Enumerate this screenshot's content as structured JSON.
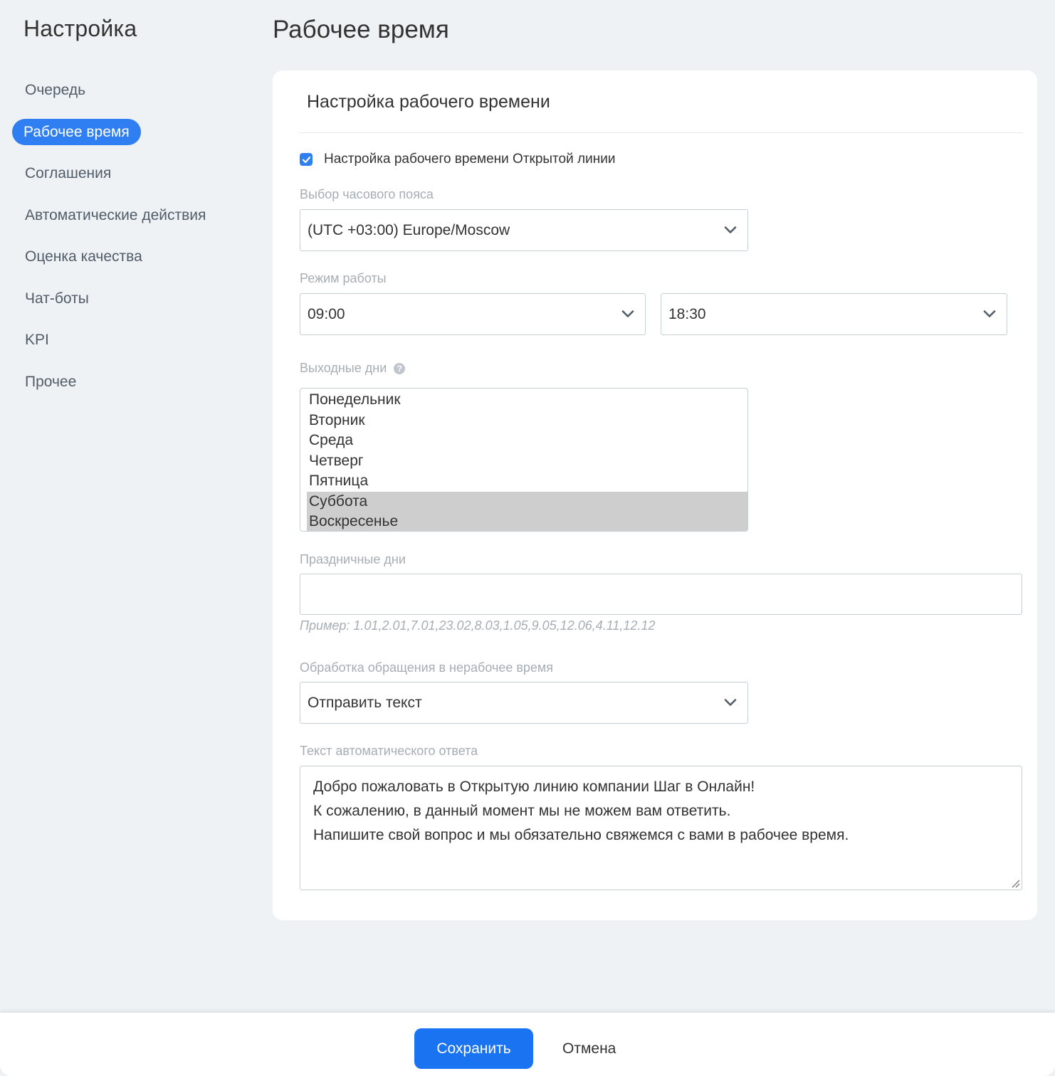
{
  "sidebar": {
    "title": "Настройка",
    "items": [
      {
        "label": "Очередь",
        "active": false
      },
      {
        "label": "Рабочее время",
        "active": true
      },
      {
        "label": "Соглашения",
        "active": false
      },
      {
        "label": "Автоматические действия",
        "active": false
      },
      {
        "label": "Оценка качества",
        "active": false
      },
      {
        "label": "Чат-боты",
        "active": false
      },
      {
        "label": "KPI",
        "active": false
      },
      {
        "label": "Прочее",
        "active": false
      }
    ],
    "active_color": "#2f7ff3"
  },
  "page": {
    "title": "Рабочее время"
  },
  "card": {
    "title": "Настройка рабочего времени",
    "enable_checkbox": {
      "label": "Настройка рабочего времени Открытой линии",
      "checked": true
    },
    "timezone": {
      "label": "Выбор часового пояса",
      "value": "(UTC +03:00) Europe/Moscow"
    },
    "work_mode": {
      "label": "Режим работы",
      "from": "09:00",
      "to": "18:30"
    },
    "weekends": {
      "label": "Выходные дни",
      "help_icon": "question-circle-icon",
      "options": [
        {
          "label": "Понедельник",
          "selected": false
        },
        {
          "label": "Вторник",
          "selected": false
        },
        {
          "label": "Среда",
          "selected": false
        },
        {
          "label": "Четверг",
          "selected": false
        },
        {
          "label": "Пятница",
          "selected": false
        },
        {
          "label": "Суббота",
          "selected": true
        },
        {
          "label": "Воскресенье",
          "selected": true
        }
      ]
    },
    "holidays": {
      "label": "Праздничные дни",
      "value": "",
      "hint": "Пример: 1.01,2.01,7.01,23.02,8.03,1.05,9.05,12.06,4.11,12.12"
    },
    "off_hours_handling": {
      "label": "Обработка обращения в нерабочее время",
      "value": "Отправить текст"
    },
    "auto_reply": {
      "label": "Текст автоматического ответа",
      "lines": [
        "Добро пожаловать в Открытую линию компании Шаг в Онлайн!",
        "К сожалению, в данный момент мы не можем вам ответить.",
        "Напишите свой вопрос и мы обязательно свяжемся с вами в рабочее время."
      ]
    }
  },
  "footer": {
    "save_label": "Сохранить",
    "cancel_label": "Отмена",
    "save_color": "#1a73f1"
  }
}
